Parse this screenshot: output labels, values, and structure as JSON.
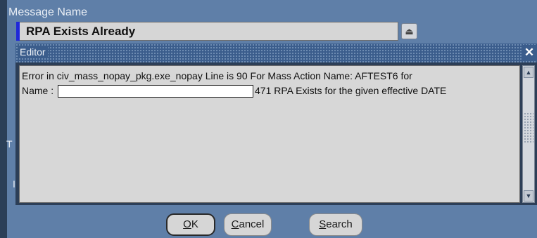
{
  "form": {
    "field_label": "Message Name",
    "message_name": "RPA Exists Already",
    "lov_button_glyph": "⏏",
    "side_letters": [
      "T",
      "I"
    ]
  },
  "editor": {
    "title": "Editor",
    "close_glyph": "✕",
    "line1": "Error in civ_mass_nopay_pkg.exe_nopay Line is 90  For Mass Action Name: AFTEST6 for",
    "line2_prefix": "Name :",
    "line2_suffix": "471 RPA Exists for the given effective DATE",
    "scroll_up_glyph": "▲",
    "scroll_down_glyph": "▼"
  },
  "buttons": {
    "ok": {
      "mnemonic": "O",
      "rest": "K"
    },
    "cancel": {
      "mnemonic": "C",
      "rest": "ancel"
    },
    "search": {
      "mnemonic": "S",
      "rest": "earch"
    }
  },
  "colors": {
    "form_background": "#5f7fa8",
    "editor_frame": "#2c3e57",
    "title_bar": "#3b5d8c",
    "field_marker": "#1f28d8"
  }
}
